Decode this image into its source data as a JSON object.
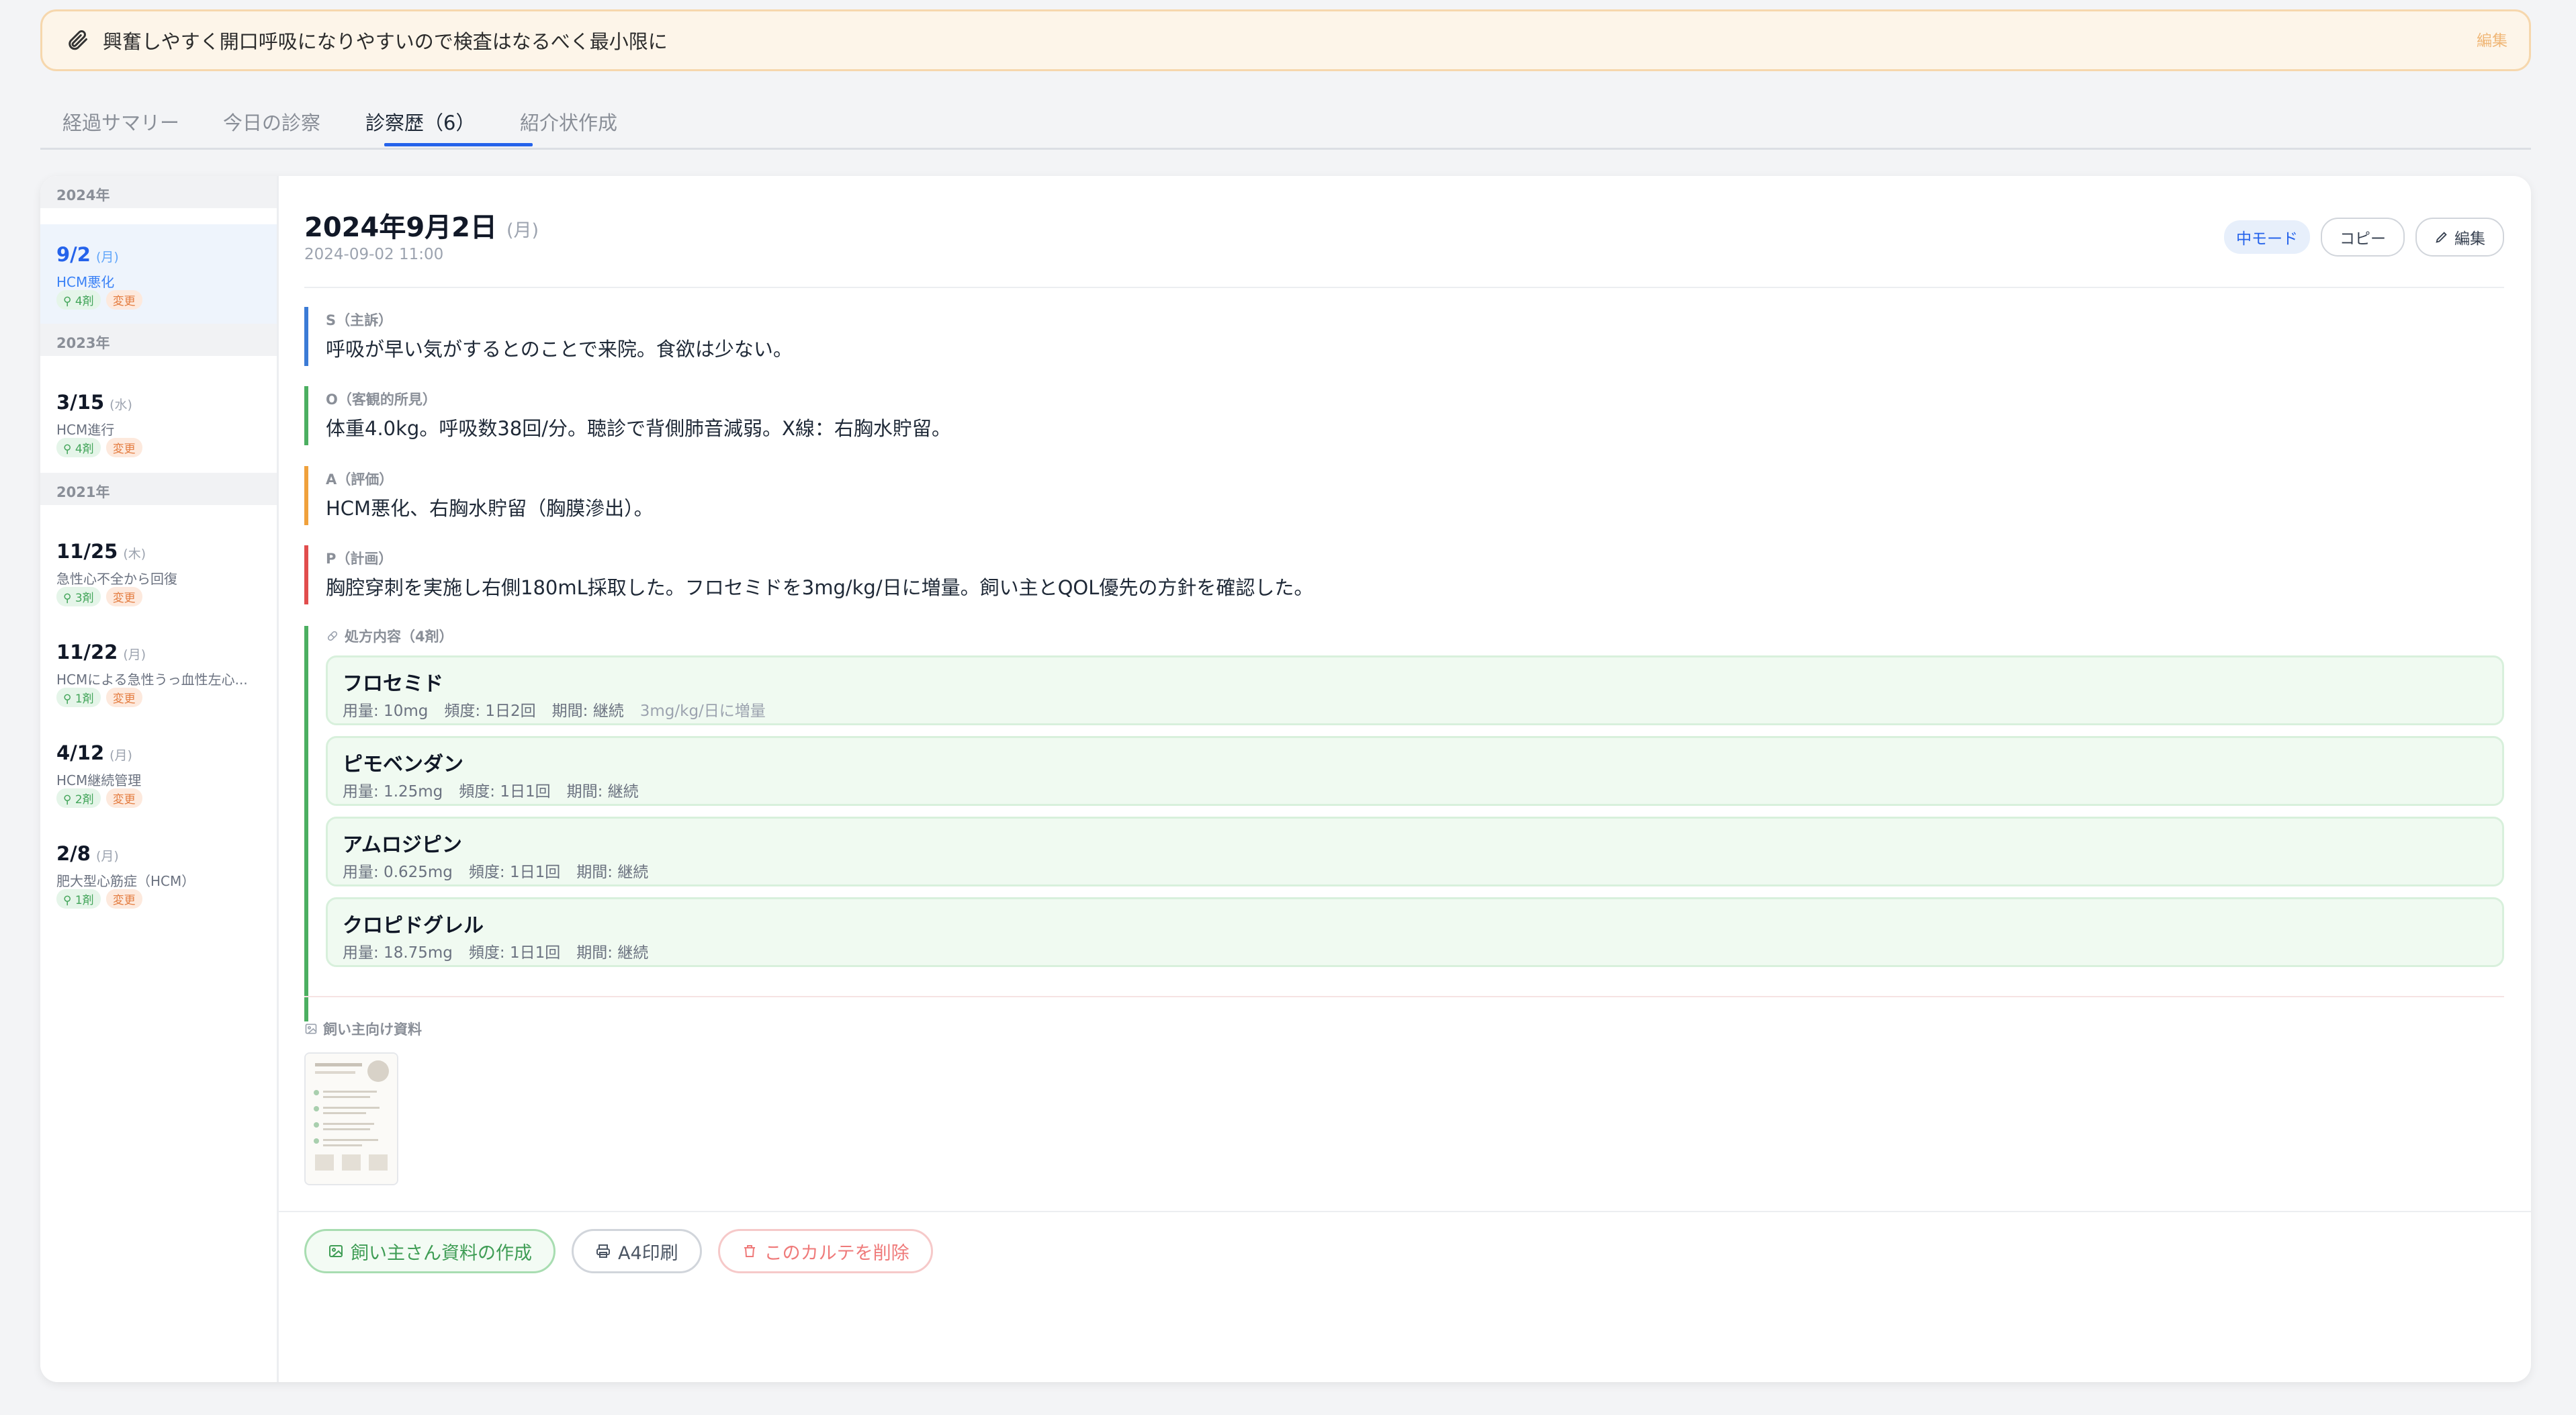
{
  "banner": {
    "icon": "paperclip-icon",
    "message": "興奮しやすく開口呼吸になりやすいので検査はなるべく最小限に",
    "edit_label": "編集"
  },
  "tabs": [
    {
      "label": "経過サマリー"
    },
    {
      "label": "今日の診察"
    },
    {
      "label": "診察歴（6）"
    },
    {
      "label": "紹介状作成"
    }
  ],
  "active_tab": "診察歴（6）",
  "sidebar": {
    "years": [
      "2024年",
      "2023年",
      "2021年"
    ],
    "visits": [
      {
        "date": "9/2",
        "dow": "(月)",
        "desc": "HCM悪化",
        "rx": "4剤",
        "change": "変更"
      },
      {
        "date": "3/15",
        "dow": "(水)",
        "desc": "HCM進行",
        "rx": "4剤",
        "change": "変更"
      },
      {
        "date": "11/25",
        "dow": "(木)",
        "desc": "急性心不全から回復",
        "rx": "3剤",
        "change": "変更"
      },
      {
        "date": "11/22",
        "dow": "(月)",
        "desc": "HCMによる急性うっ血性左心...",
        "rx": "1剤",
        "change": "変更"
      },
      {
        "date": "4/12",
        "dow": "(月)",
        "desc": "HCM継続管理",
        "rx": "2剤",
        "change": "変更"
      },
      {
        "date": "2/8",
        "dow": "(月)",
        "desc": "肥大型心筋症（HCM）",
        "rx": "1剤",
        "change": "変更"
      }
    ]
  },
  "record": {
    "title": "2024年9月2日",
    "dow": "(月)",
    "timestamp": "2024-09-02 11:00",
    "mode_badge": "中モード",
    "copy_label": "コピー",
    "edit_label": "編集",
    "soap": [
      {
        "label": "S（主訴）",
        "text": "呼吸が早い気がするとのことで来院。食欲は少ない。",
        "color": "#3b7bd6"
      },
      {
        "label": "O（客観的所見）",
        "text": "体重4.0kg。呼吸数38回/分。聴診で背側肺音減弱。X線：右胸水貯留。",
        "color": "#4caf61"
      },
      {
        "label": "A（評価）",
        "text": "HCM悪化、右胸水貯留（胸膜滲出）。",
        "color": "#f0a13c"
      },
      {
        "label": "P（計画）",
        "text": "胸腔穿刺を実施し右側180mL採取した。フロセミドを3mg/kg/日に増量。飼い主とQOL優先の方針を確認した。",
        "color": "#e14d4d"
      }
    ],
    "rx_header": "処方内容（4剤）",
    "drugs": [
      {
        "name": "フロセミド",
        "dose": "用量: 10mg",
        "freq": "頻度: 1日2回",
        "period": "期間: 継続",
        "note": "3mg/kg/日に増量"
      },
      {
        "name": "ピモベンダン",
        "dose": "用量: 1.25mg",
        "freq": "頻度: 1日1回",
        "period": "期間: 継続",
        "note": ""
      },
      {
        "name": "アムロジピン",
        "dose": "用量: 0.625mg",
        "freq": "頻度: 1日1回",
        "period": "期間: 継続",
        "note": ""
      },
      {
        "name": "クロピドグレル",
        "dose": "用量: 18.75mg",
        "freq": "頻度: 1日1回",
        "period": "期間: 継続",
        "note": ""
      }
    ],
    "materials_label": "飼い主向け資料"
  },
  "bottom_actions": {
    "create_material": "飼い主さん資料の作成",
    "print": "A4印刷",
    "delete": "このカルテを削除"
  }
}
